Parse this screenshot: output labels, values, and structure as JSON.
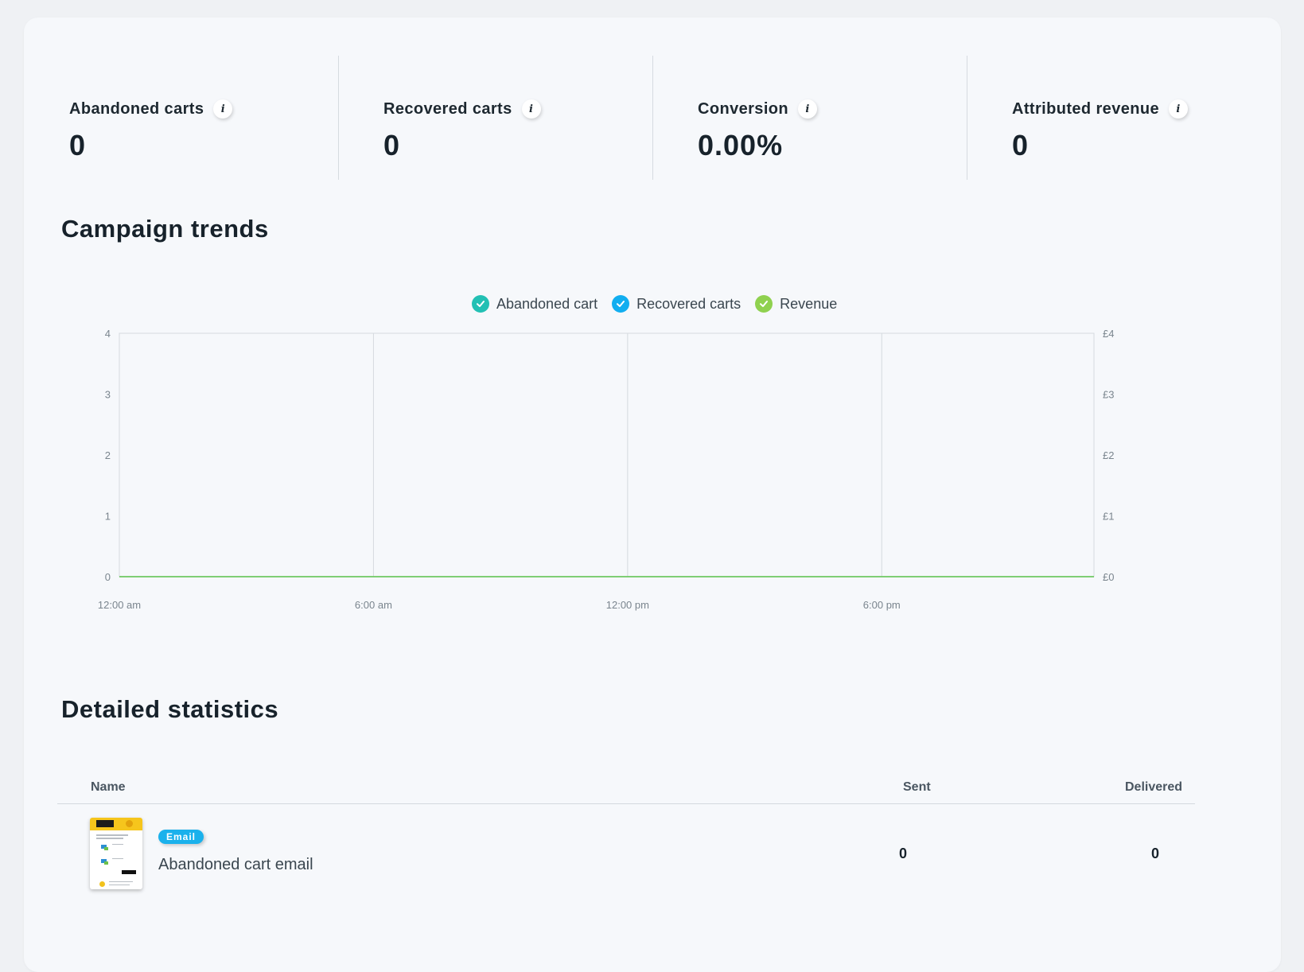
{
  "kpis": [
    {
      "label": "Abandoned carts",
      "value": "0",
      "info_icon": "info-icon"
    },
    {
      "label": "Recovered carts",
      "value": "0",
      "info_icon": "info-icon"
    },
    {
      "label": "Conversion",
      "value": "0.00%",
      "info_icon": "info-icon"
    },
    {
      "label": "Attributed revenue",
      "value": "0",
      "info_icon": "info-icon"
    }
  ],
  "trends": {
    "title": "Campaign trends",
    "legend": [
      {
        "label": "Abandoned cart",
        "color": "#22c0b4",
        "icon": "check-circle-icon"
      },
      {
        "label": "Recovered carts",
        "color": "#11aef0",
        "icon": "check-circle-icon"
      },
      {
        "label": "Revenue",
        "color": "#8fd14f",
        "icon": "check-circle-icon"
      }
    ]
  },
  "chart_data": {
    "type": "line",
    "x": [
      "12:00 am",
      "6:00 am",
      "12:00 pm",
      "6:00 pm"
    ],
    "x_ticks": [
      "12:00 am",
      "6:00 am",
      "12:00 pm",
      "6:00 pm"
    ],
    "y_left_ticks": [
      "0",
      "1",
      "2",
      "3",
      "4"
    ],
    "y_right_ticks": [
      "£0",
      "£1",
      "£2",
      "£3",
      "£4"
    ],
    "ylim": [
      0,
      4
    ],
    "grid": "vertical",
    "legend_position": "top",
    "series": [
      {
        "name": "Abandoned cart",
        "color": "#22c0b4",
        "values": [
          0,
          0,
          0,
          0,
          0
        ]
      },
      {
        "name": "Recovered carts",
        "color": "#11aef0",
        "values": [
          0,
          0,
          0,
          0,
          0
        ]
      },
      {
        "name": "Revenue",
        "color": "#8fd14f",
        "values": [
          0,
          0,
          0,
          0,
          0
        ]
      }
    ]
  },
  "stats": {
    "title": "Detailed statistics",
    "columns": {
      "name": "Name",
      "sent": "Sent",
      "delivered": "Delivered"
    },
    "rows": [
      {
        "badge": "Email",
        "name": "Abandoned cart email",
        "sent": "0",
        "delivered": "0"
      }
    ]
  }
}
